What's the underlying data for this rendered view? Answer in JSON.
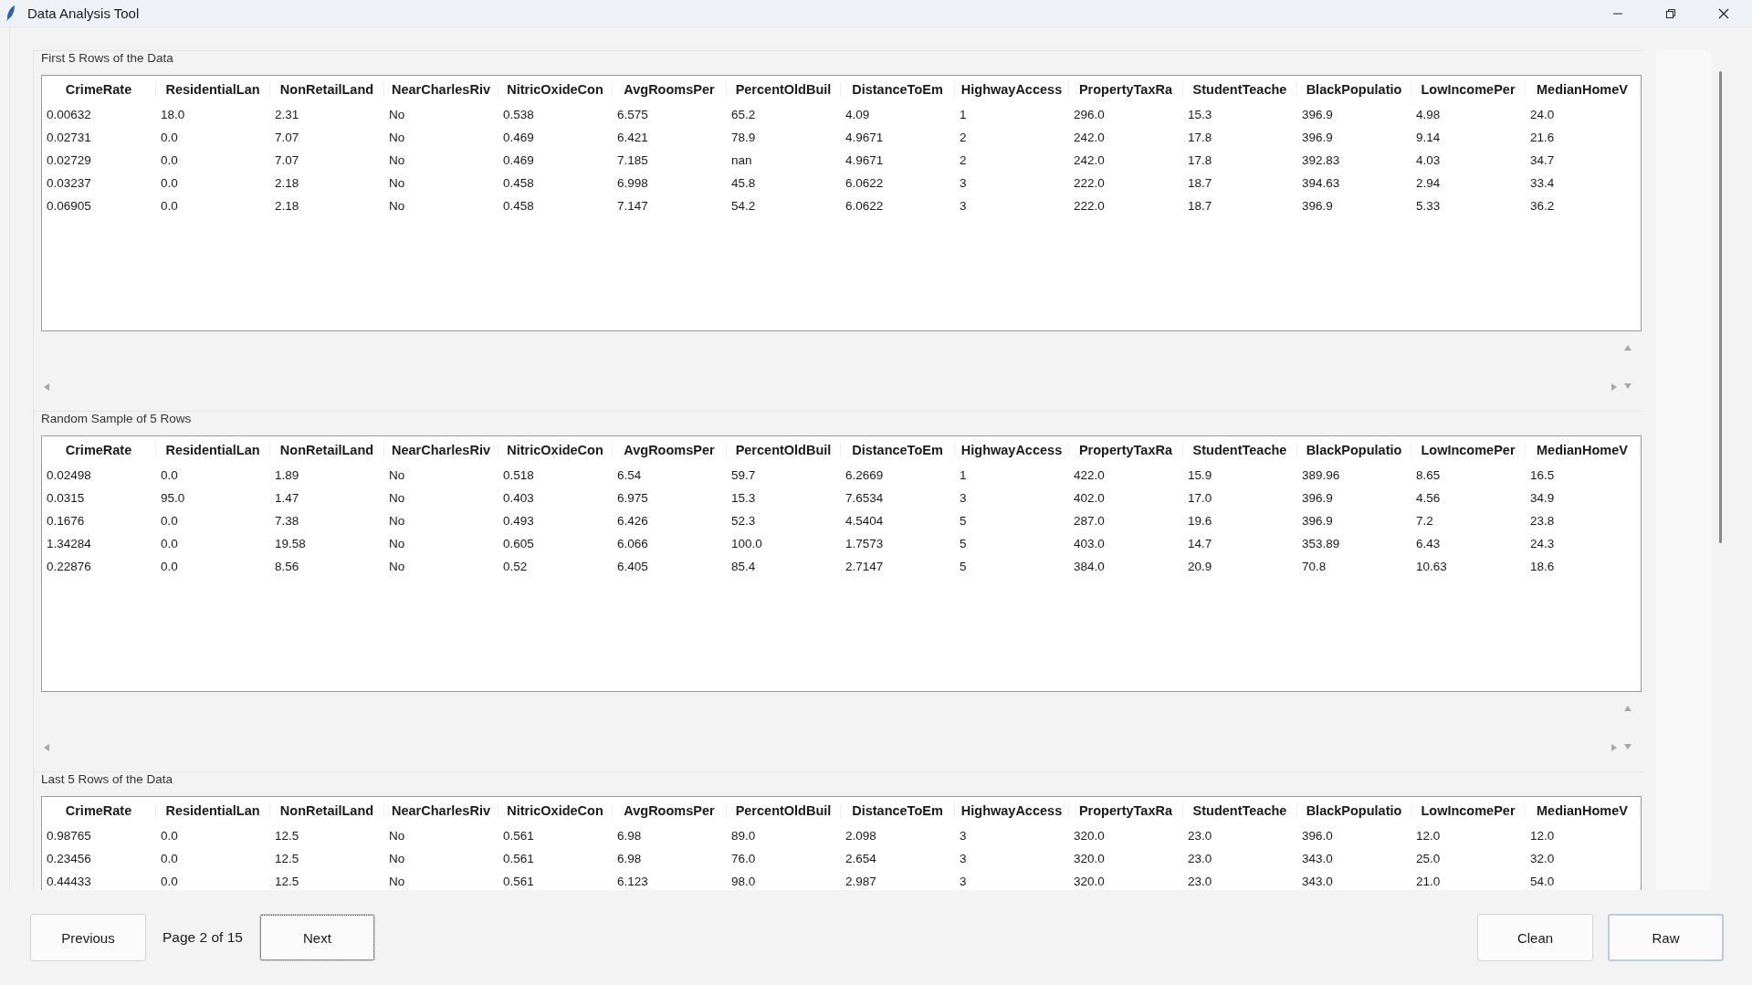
{
  "window": {
    "title": "Data Analysis Tool"
  },
  "sections": [
    {
      "title": "First 5 Rows of the Data",
      "has_scrollbars": true,
      "columns": [
        "CrimeRate",
        "ResidentialLan",
        "NonRetailLand",
        "NearCharlesRiv",
        "NitricOxideCon",
        "AvgRoomsPer",
        "PercentOldBuil",
        "DistanceToEm",
        "HighwayAccess",
        "PropertyTaxRa",
        "StudentTeache",
        "BlackPopulatio",
        "LowIncomePer",
        "MedianHomeV"
      ],
      "rows": [
        [
          "0.00632",
          "18.0",
          "2.31",
          "No",
          "0.538",
          "6.575",
          "65.2",
          "4.09",
          "1",
          "296.0",
          "15.3",
          "396.9",
          "4.98",
          "24.0"
        ],
        [
          "0.02731",
          "0.0",
          "7.07",
          "No",
          "0.469",
          "6.421",
          "78.9",
          "4.9671",
          "2",
          "242.0",
          "17.8",
          "396.9",
          "9.14",
          "21.6"
        ],
        [
          "0.02729",
          "0.0",
          "7.07",
          "No",
          "0.469",
          "7.185",
          "nan",
          "4.9671",
          "2",
          "242.0",
          "17.8",
          "392.83",
          "4.03",
          "34.7"
        ],
        [
          "0.03237",
          "0.0",
          "2.18",
          "No",
          "0.458",
          "6.998",
          "45.8",
          "6.0622",
          "3",
          "222.0",
          "18.7",
          "394.63",
          "2.94",
          "33.4"
        ],
        [
          "0.06905",
          "0.0",
          "2.18",
          "No",
          "0.458",
          "7.147",
          "54.2",
          "6.0622",
          "3",
          "222.0",
          "18.7",
          "396.9",
          "5.33",
          "36.2"
        ]
      ]
    },
    {
      "title": "Random Sample of 5 Rows",
      "has_scrollbars": true,
      "columns": [
        "CrimeRate",
        "ResidentialLan",
        "NonRetailLand",
        "NearCharlesRiv",
        "NitricOxideCon",
        "AvgRoomsPer",
        "PercentOldBuil",
        "DistanceToEm",
        "HighwayAccess",
        "PropertyTaxRa",
        "StudentTeache",
        "BlackPopulatio",
        "LowIncomePer",
        "MedianHomeV"
      ],
      "rows": [
        [
          "0.02498",
          "0.0",
          "1.89",
          "No",
          "0.518",
          "6.54",
          "59.7",
          "6.2669",
          "1",
          "422.0",
          "15.9",
          "389.96",
          "8.65",
          "16.5"
        ],
        [
          "0.0315",
          "95.0",
          "1.47",
          "No",
          "0.403",
          "6.975",
          "15.3",
          "7.6534",
          "3",
          "402.0",
          "17.0",
          "396.9",
          "4.56",
          "34.9"
        ],
        [
          "0.1676",
          "0.0",
          "7.38",
          "No",
          "0.493",
          "6.426",
          "52.3",
          "4.5404",
          "5",
          "287.0",
          "19.6",
          "396.9",
          "7.2",
          "23.8"
        ],
        [
          "1.34284",
          "0.0",
          "19.58",
          "No",
          "0.605",
          "6.066",
          "100.0",
          "1.7573",
          "5",
          "403.0",
          "14.7",
          "353.89",
          "6.43",
          "24.3"
        ],
        [
          "0.22876",
          "0.0",
          "8.56",
          "No",
          "0.52",
          "6.405",
          "85.4",
          "2.7147",
          "5",
          "384.0",
          "20.9",
          "70.8",
          "10.63",
          "18.6"
        ]
      ]
    },
    {
      "title": "Last 5 Rows of the Data",
      "columns": [
        "CrimeRate",
        "ResidentialLan",
        "NonRetailLand",
        "NearCharlesRiv",
        "NitricOxideCon",
        "AvgRoomsPer",
        "PercentOldBuil",
        "DistanceToEm",
        "HighwayAccess",
        "PropertyTaxRa",
        "StudentTeache",
        "BlackPopulatio",
        "LowIncomePer",
        "MedianHomeV"
      ],
      "rows": [
        [
          "0.98765",
          "0.0",
          "12.5",
          "No",
          "0.561",
          "6.98",
          "89.0",
          "2.098",
          "3",
          "320.0",
          "23.0",
          "396.0",
          "12.0",
          "12.0"
        ],
        [
          "0.23456",
          "0.0",
          "12.5",
          "No",
          "0.561",
          "6.98",
          "76.0",
          "2.654",
          "3",
          "320.0",
          "23.0",
          "343.0",
          "25.0",
          "32.0"
        ],
        [
          "0.44433",
          "0.0",
          "12.5",
          "No",
          "0.561",
          "6.123",
          "98.0",
          "2.987",
          "3",
          "320.0",
          "23.0",
          "343.0",
          "21.0",
          "54.0"
        ]
      ]
    }
  ],
  "pager": {
    "previous": {
      "label": "Previous",
      "focused": false,
      "default": false
    },
    "page_text": "Page 2 of 15",
    "next": {
      "label": "Next",
      "focused": true,
      "default": false
    }
  },
  "actions": [
    {
      "label": "Clean",
      "focused": false,
      "default": false
    },
    {
      "label": "Raw",
      "focused": false,
      "default": true
    }
  ]
}
